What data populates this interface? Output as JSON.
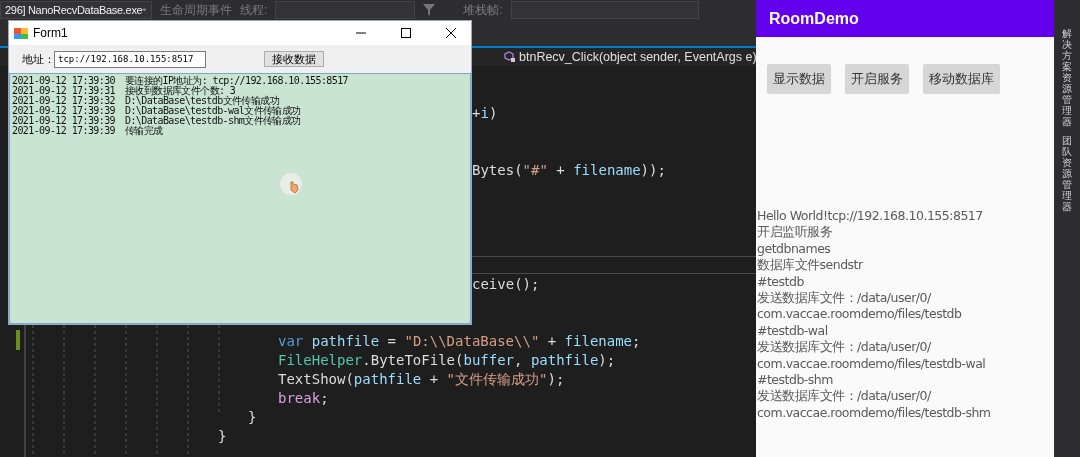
{
  "ide": {
    "toolbar": {
      "process": "296] NanoRecvDataBase.exe",
      "lifecycle": "生命周期事件",
      "thread_label": "线程:",
      "stack_label": "堆栈帧:"
    },
    "navigation": {
      "member": "btnRecv_Click(object sender, EventArgs e)"
    },
    "code_lines": [
      {
        "kind": "cut",
        "tokens": [
          {
            "t": "+",
            "kind": "plain"
          },
          {
            "t": "i",
            "kind": "ident"
          },
          {
            "t": ")",
            "kind": "plain"
          }
        ]
      },
      {
        "kind": "cut",
        "tokens": [
          {
            "t": "Bytes(",
            "kind": "plain"
          },
          {
            "t": "\"#\"",
            "kind": "string"
          },
          {
            "t": " + ",
            "kind": "plain"
          },
          {
            "t": "filename",
            "kind": "ident"
          },
          {
            "t": "));",
            "kind": "plain"
          }
        ]
      },
      {
        "kind": "cut",
        "tokens": [
          {
            "t": "ceive();",
            "kind": "plain"
          }
        ]
      },
      {
        "kind": "statement",
        "tokens": [
          {
            "t": "var",
            "kind": "keyword"
          },
          {
            "t": " pathfile",
            "kind": "ident"
          },
          {
            "t": " = ",
            "kind": "plain"
          },
          {
            "t": "\"D:\\\\DataBase\\\\\"",
            "kind": "string"
          },
          {
            "t": " + ",
            "kind": "plain"
          },
          {
            "t": "filename",
            "kind": "ident"
          },
          {
            "t": ";",
            "kind": "plain"
          }
        ]
      },
      {
        "kind": "statement",
        "tokens": [
          {
            "t": "FileHelper",
            "kind": "type"
          },
          {
            "t": ".ByteToFile(",
            "kind": "plain"
          },
          {
            "t": "buffer",
            "kind": "ident"
          },
          {
            "t": ", ",
            "kind": "plain"
          },
          {
            "t": "pathfile",
            "kind": "ident"
          },
          {
            "t": ");",
            "kind": "plain"
          }
        ]
      },
      {
        "kind": "statement",
        "tokens": [
          {
            "t": "TextShow(",
            "kind": "plain"
          },
          {
            "t": "pathfile",
            "kind": "ident"
          },
          {
            "t": " + ",
            "kind": "plain"
          },
          {
            "t": "\"文件传输成功\"",
            "kind": "string"
          },
          {
            "t": ");",
            "kind": "plain"
          }
        ]
      },
      {
        "kind": "statement",
        "tokens": [
          {
            "t": "break",
            "kind": "control"
          },
          {
            "t": ";",
            "kind": "plain"
          }
        ]
      },
      {
        "kind": "inner_brace",
        "tokens": [
          {
            "t": "}",
            "kind": "plain"
          }
        ]
      },
      {
        "kind": "outer_brace",
        "tokens": [
          {
            "t": "}",
            "kind": "plain"
          }
        ]
      }
    ]
  },
  "form_window": {
    "title": "Form1",
    "address_label": "地址：",
    "address_value": "tcp://192.168.10.155:8517",
    "receive_button": "接收数据",
    "log": [
      {
        "time": "2021-09-12 17:39:30",
        "message": "要连接的IP地址为: tcp://192.168.10.155:8517"
      },
      {
        "time": "2021-09-12 17:39:31",
        "message": "接收到数据库文件个数: 3"
      },
      {
        "time": "2021-09-12 17:39:32",
        "message": "D:\\DataBase\\testdb文件传输成功"
      },
      {
        "time": "2021-09-12 17:39:39",
        "message": "D:\\DataBase\\testdb-wal文件传输成功"
      },
      {
        "time": "2021-09-12 17:39:39",
        "message": "D:\\DataBase\\testdb-shm文件传输成功"
      },
      {
        "time": "2021-09-12 17:39:39",
        "message": "传输完成"
      }
    ]
  },
  "phone": {
    "app_title": "RoomDemo",
    "buttons": [
      "显示数据",
      "开启服务",
      "移动数据库"
    ],
    "output_lines": [
      "Hello World!tcp://192.168.10.155:8517",
      "开启监听服务",
      "getdbnames",
      "数据库文件sendstr",
      "#testdb",
      "发送数据库文件：/data/user/0/",
      "com.vaccae.roomdemo/files/testdb",
      "#testdb-wal",
      "发送数据库文件：/data/user/0/",
      "com.vaccae.roomdemo/files/testdb-wal",
      "#testdb-shm",
      "发送数据库文件：/data/user/0/",
      "com.vaccae.roomdemo/files/testdb-shm"
    ]
  },
  "side_tabs": [
    "解决方案资源管理器",
    "团队资源管理器"
  ]
}
